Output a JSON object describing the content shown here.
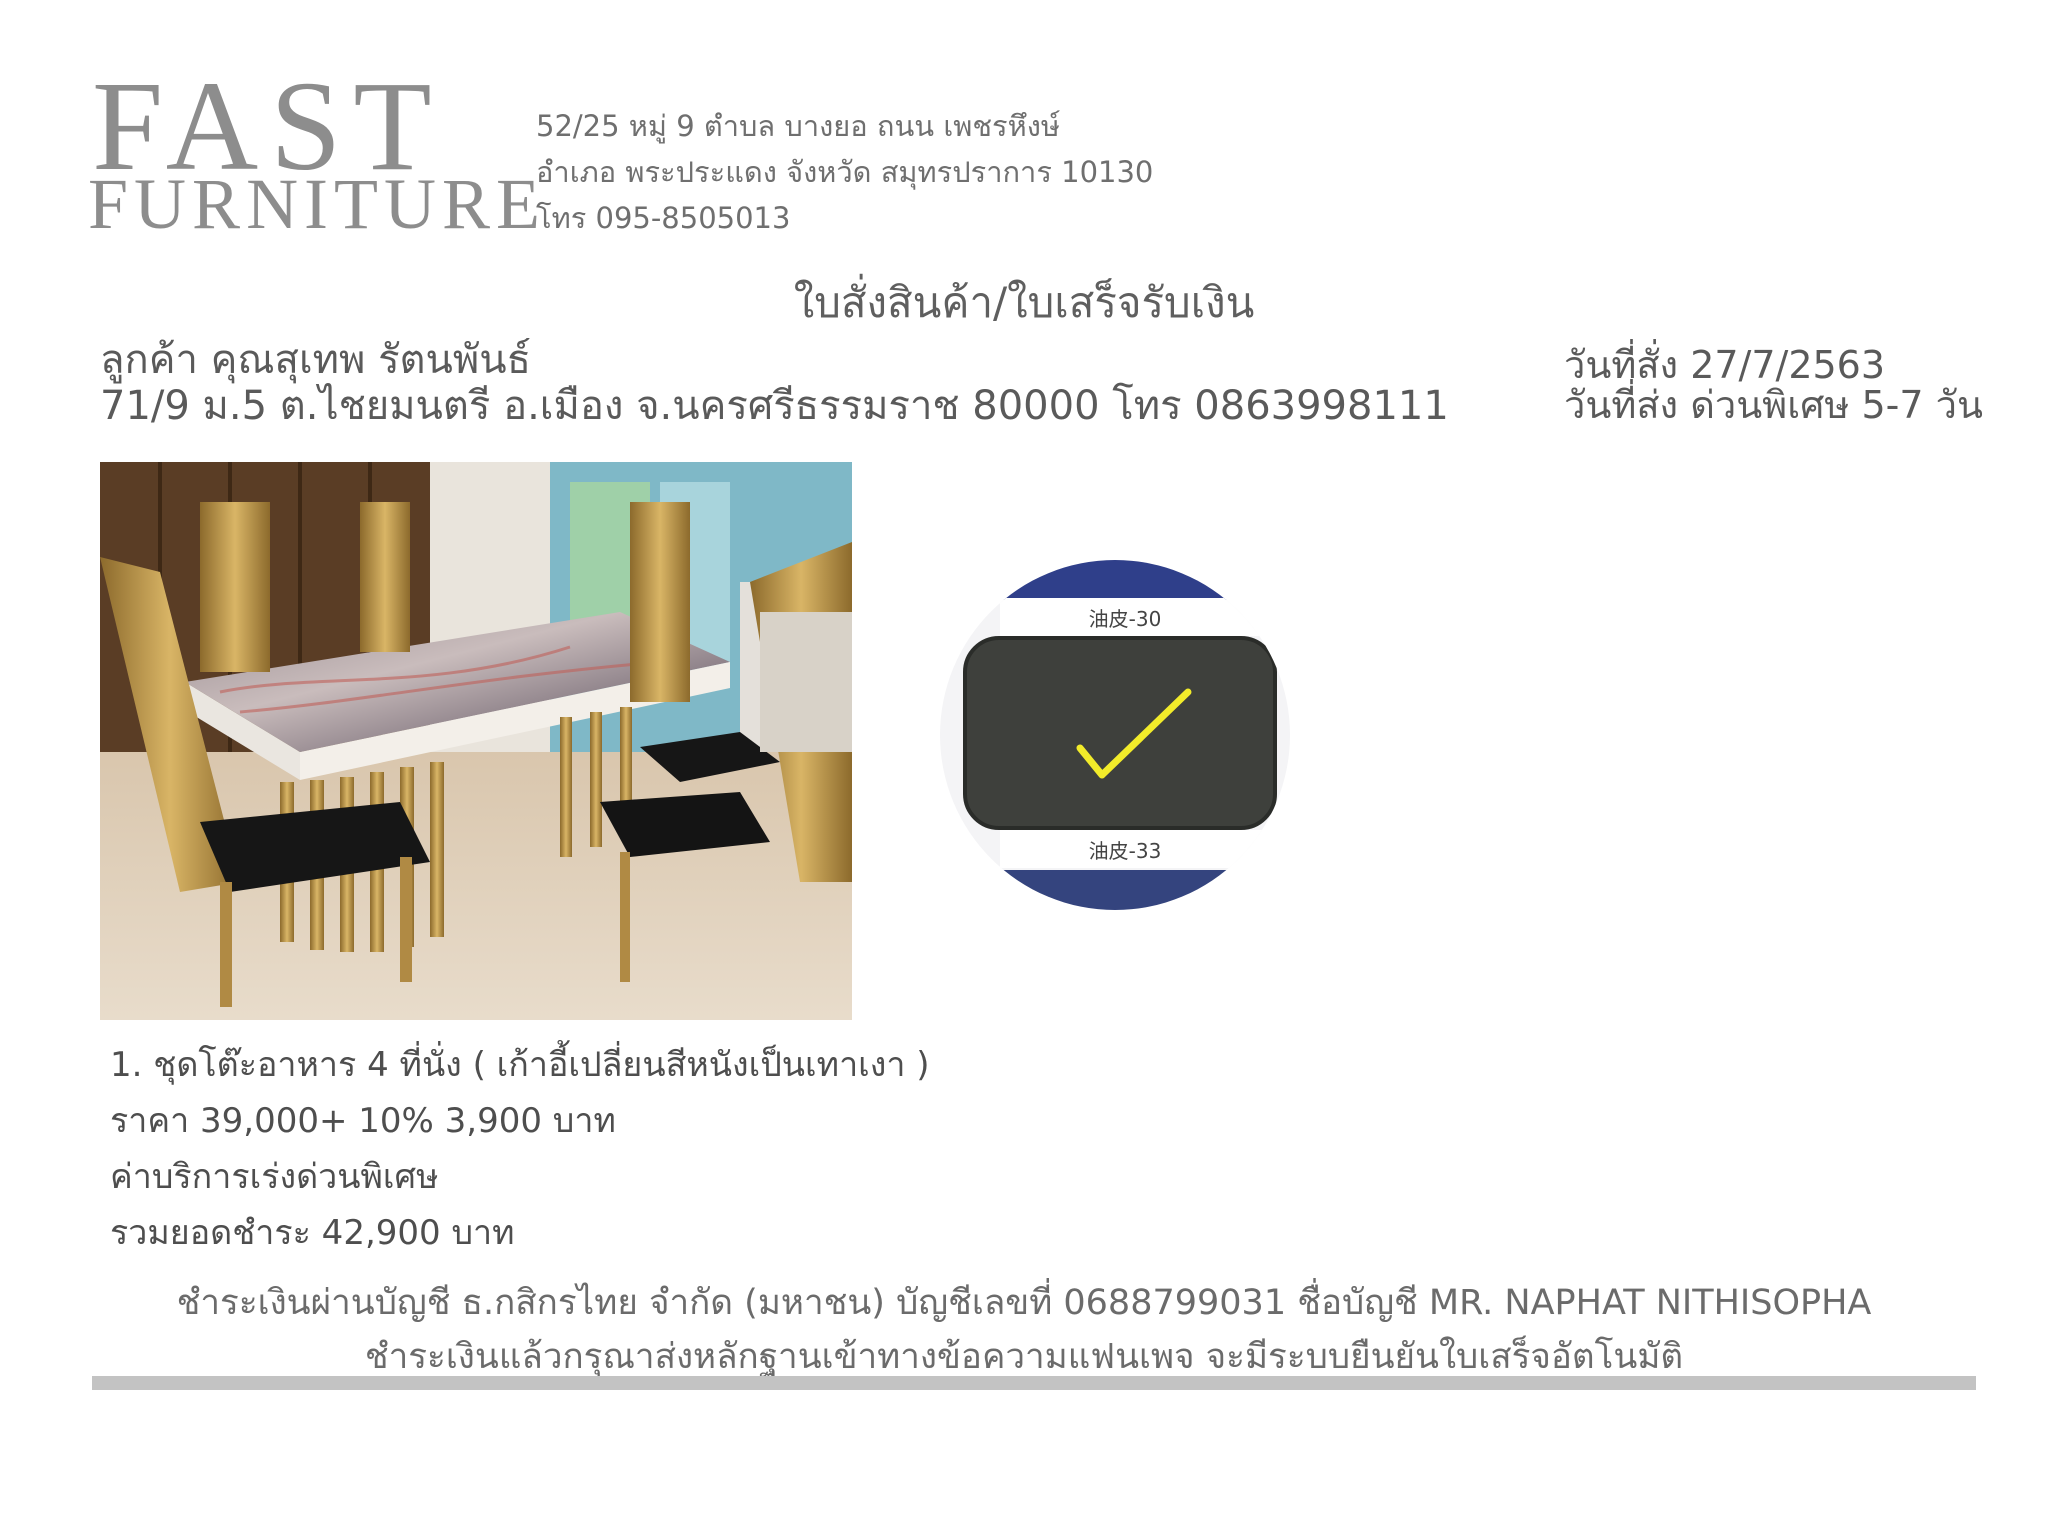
{
  "company": {
    "logo_line1": "FAST",
    "logo_line2": "FURNITURE",
    "address_line1": "52/25 หมู่ 9 ตำบล บางยอ ถนน เพชรหึงษ์",
    "address_line2": "อำเภอ พระประแดง จังหวัด สมุทรปราการ 10130",
    "phone": "โทร 095-8505013"
  },
  "document": {
    "title": "ใบสั่งสินค้า/ใบเสร็จรับเงิน"
  },
  "customer": {
    "name": "ลูกค้า คุณสุเทพ รัตนพันธ์",
    "address": "71/9 ม.5 ต.ไชยมนตรี อ.เมือง จ.นครศรีธรรมราช 80000 โทร 0863998111"
  },
  "dates": {
    "order_date": "วันที่สั่ง 27/7/2563",
    "delivery": "วันที่ส่ง ด่วนพิเศษ 5-7 วัน"
  },
  "swatch": {
    "label_top": "油皮-30",
    "label_bottom": "油皮-33"
  },
  "items": [
    "1. ชุดโต๊ะอาหาร 4 ที่นั่ง ( เก้าอี้เปลี่ยนสีหนังเป็นเทาเงา )",
    "ราคา 39,000+ 10% 3,900 บาท",
    "ค่าบริการเร่งด่วนพิเศษ",
    "รวมยอดชำระ 42,900 บาท"
  ],
  "payment": {
    "line1": "ชำระเงินผ่านบัญชี ธ.กสิกรไทย จำกัด (มหาชน) บัญชีเลขที่ 0688799031 ชื่อบัญชี MR. NAPHAT NITHISOPHA",
    "line2": "ชำระเงินแล้วกรุณาส่งหลักฐานเข้าทางข้อความแฟนเพจ จะมีระบบยืนยันใบเสร็จอัตโนมัติ"
  }
}
